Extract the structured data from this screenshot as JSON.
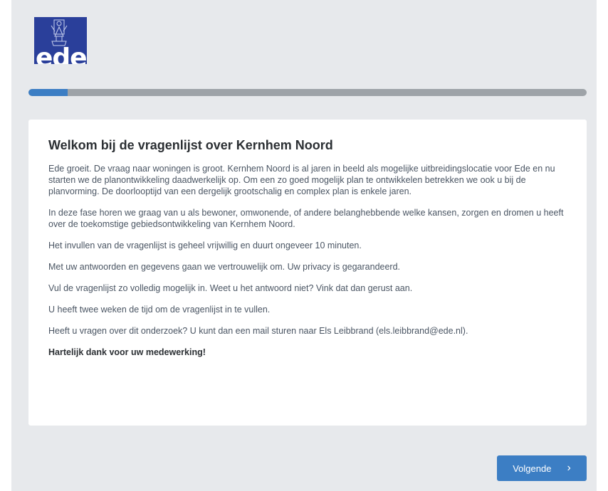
{
  "header": {
    "logo_text": "ede",
    "logo_color": "#2a3f9a"
  },
  "progress": {
    "fraction": 0.07,
    "fill_color": "#3c7ec4",
    "track_color": "#9ea3a8"
  },
  "intro": {
    "title": "Welkom bij de vragenlijst over Kernhem Noord",
    "paragraphs": [
      "Ede groeit. De vraag naar woningen is groot. Kernhem Noord is al jaren in beeld als mogelijke uitbreidingslocatie voor Ede en nu starten we de planontwikkeling daadwerkelijk op. Om een zo goed mogelijk plan te ontwikkelen betrekken we ook u bij de planvorming. De doorlooptijd van een dergelijk grootschalig en complex plan is enkele jaren.",
      "In deze fase horen we graag van u als bewoner, omwonende, of andere belanghebbende welke kansen, zorgen en dromen u heeft over de toekomstige gebiedsontwikkeling van Kernhem Noord.",
      "Het invullen van de vragenlijst is geheel vrijwillig en duurt ongeveer 10 minuten.",
      "Met uw antwoorden en gegevens gaan we vertrouwelijk om. Uw privacy is gegarandeerd.",
      "Vul de vragenlijst zo volledig mogelijk in. Weet u het antwoord niet? Vink dat dan gerust aan.",
      "U heeft twee weken de tijd om de vragenlijst in te vullen.",
      "Heeft u vragen over dit onderzoek? U kunt dan een mail sturen naar Els Leibbrand (els.leibbrand@ede.nl)."
    ],
    "closing": "Hartelijk dank voor uw medewerking!"
  },
  "navigation": {
    "next_label": "Volgende",
    "next_icon": "chevron-right-icon"
  }
}
